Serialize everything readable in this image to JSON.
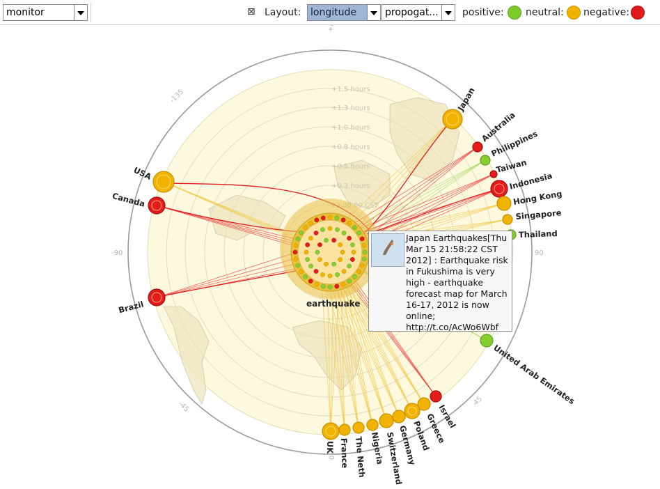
{
  "toolbar": {
    "view_select": "monitor",
    "layout_label": "Layout:",
    "layout_select": "longitude",
    "mode_select": "propogat...",
    "legend": [
      {
        "label": "positive:",
        "color": "#7ecb2c"
      },
      {
        "label": "neutral:",
        "color": "#f2b200"
      },
      {
        "label": "negative:",
        "color": "#e11b1b"
      }
    ]
  },
  "radar": {
    "angle_ticks": [
      "+/-180",
      "-135",
      "-90",
      "-45",
      "0",
      "45",
      "90"
    ],
    "time_rings": [
      "+1.5 hours",
      "+1.3 hours",
      "+1.0 hours",
      "+0.8 hours",
      "+0.5 hours",
      "+0.3 hours",
      "23:00:00 CST"
    ],
    "center_label": "earthquake"
  },
  "countries": [
    {
      "name": "Japan",
      "sentiment": "neutral"
    },
    {
      "name": "Australia",
      "sentiment": "negative"
    },
    {
      "name": "Philippines",
      "sentiment": "positive"
    },
    {
      "name": "Taiwan",
      "sentiment": "negative"
    },
    {
      "name": "Indonesia",
      "sentiment": "negative"
    },
    {
      "name": "Hong Kong",
      "sentiment": "neutral"
    },
    {
      "name": "Singapore",
      "sentiment": "neutral"
    },
    {
      "name": "Thailand",
      "sentiment": "positive"
    },
    {
      "name": "United Arab Emirates",
      "sentiment": "positive"
    },
    {
      "name": "Israel",
      "sentiment": "negative"
    },
    {
      "name": "Greece",
      "sentiment": "neutral"
    },
    {
      "name": "Poland",
      "sentiment": "neutral"
    },
    {
      "name": "Germany",
      "sentiment": "neutral"
    },
    {
      "name": "Switzerland",
      "sentiment": "neutral"
    },
    {
      "name": "Nigeria",
      "sentiment": "neutral"
    },
    {
      "name": "The Neth",
      "sentiment": "neutral"
    },
    {
      "name": "France",
      "sentiment": "neutral"
    },
    {
      "name": "UK",
      "sentiment": "neutral"
    },
    {
      "name": "USA",
      "sentiment": "neutral"
    },
    {
      "name": "Canada",
      "sentiment": "negative"
    },
    {
      "name": "Brazil",
      "sentiment": "negative"
    }
  ],
  "tooltip": {
    "text": "Japan Earthquakes[Thu Mar 15 21:58:22 CST 2012] : Earthquake risk in Fukushima is very high - earthquake forecast map for March 16-17, 2012 is now online; http://t.co/AcWo6Wbf"
  }
}
